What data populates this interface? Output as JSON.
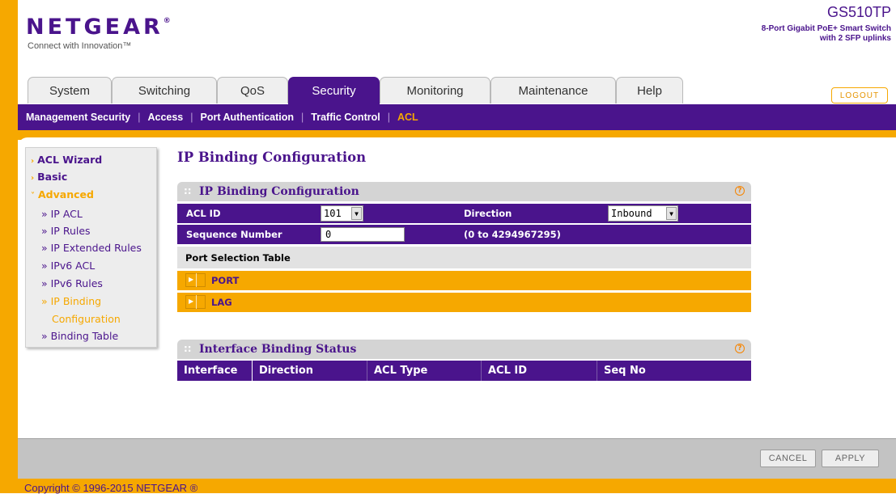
{
  "brand": {
    "logo": "NETGEAR",
    "logo_mark": "®",
    "tagline": "Connect with Innovation™",
    "model": "GS510TP",
    "model_desc_line1": "8-Port Gigabit PoE+ Smart Switch",
    "model_desc_line2": "with 2 SFP uplinks"
  },
  "tabs": [
    {
      "label": "System"
    },
    {
      "label": "Switching"
    },
    {
      "label": "QoS"
    },
    {
      "label": "Security"
    },
    {
      "label": "Monitoring"
    },
    {
      "label": "Maintenance"
    },
    {
      "label": "Help"
    }
  ],
  "active_tab": "Security",
  "logout_label": "LOGOUT",
  "subnav": [
    {
      "label": "Management Security"
    },
    {
      "label": "Access"
    },
    {
      "label": "Port Authentication"
    },
    {
      "label": "Traffic Control"
    },
    {
      "label": "ACL"
    }
  ],
  "subnav_separator": "|",
  "sidebar": {
    "items": [
      {
        "label": "ACL Wizard"
      },
      {
        "label": "Basic"
      },
      {
        "label": "Advanced"
      }
    ],
    "sub_items": [
      {
        "label": "» IP ACL"
      },
      {
        "label": "» IP Rules"
      },
      {
        "label": "» IP Extended Rules"
      },
      {
        "label": "» IPv6 ACL"
      },
      {
        "label": "» IPv6 Rules"
      },
      {
        "label": "» IP Binding"
      },
      {
        "label": "Configuration"
      },
      {
        "label": "» Binding Table"
      }
    ]
  },
  "page_title": "IP Binding Configuration",
  "config_panel": {
    "title": "IP Binding Configuration",
    "acl_id_label": "ACL ID",
    "acl_id_value": "101",
    "direction_label": "Direction",
    "direction_value": "Inbound",
    "seq_label": "Sequence Number",
    "seq_value": "0",
    "seq_range": "(0 to 4294967295)",
    "port_table_label": "Port Selection Table",
    "port_label": "PORT",
    "lag_label": "LAG"
  },
  "status_panel": {
    "title": "Interface Binding Status",
    "columns": [
      "Interface",
      "Direction",
      "ACL Type",
      "ACL ID",
      "Seq No"
    ]
  },
  "buttons": {
    "cancel": "CANCEL",
    "apply": "APPLY"
  },
  "help_glyph": "?",
  "copyright": "Copyright © 1996-2015 NETGEAR ®",
  "colors": {
    "purple": "#4a148c",
    "orange": "#f6a800"
  }
}
